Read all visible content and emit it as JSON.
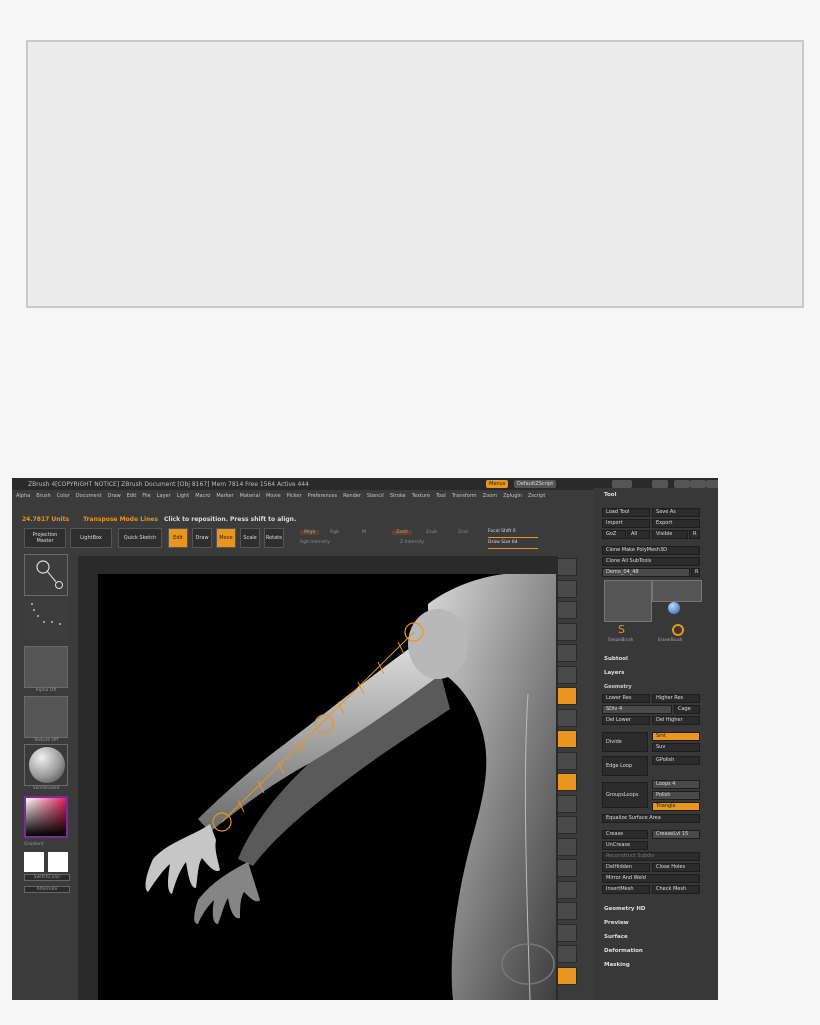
{
  "app": {
    "title": "ZBrush 4[COPYRIGHT NOTICE]  ZBrush Document  [Obj 8167] Mem 7814 Free 1564 Active 444",
    "menu": [
      "Alpha",
      "Brush",
      "Color",
      "Document",
      "Draw",
      "Edit",
      "File",
      "Layer",
      "Light",
      "Macro",
      "Marker",
      "Material",
      "Movie",
      "Picker",
      "Preferences",
      "Render",
      "Stencil",
      "Stroke",
      "Texture",
      "Tool",
      "Transform",
      "Zoom",
      "Zplugin",
      "Zscript"
    ],
    "top_buttons": {
      "menus": "Menus",
      "default_script": "DefaultZScript"
    },
    "status": {
      "value": "24.7817 Units",
      "mode": "Transpose Mode Lines",
      "hint": "Click to reposition. Press shift to align."
    },
    "toolbar": {
      "projection_master": "Projection Master",
      "lightbox": "LightBox",
      "quick_sketch": "Quick Sketch",
      "edit": "Edit",
      "draw": "Draw",
      "move": "Move",
      "scale": "Scale",
      "rotate": "Rotate",
      "mrgb": "Mrgb",
      "rgb": "Rgb",
      "m": "M",
      "zadd": "Zadd",
      "zsub": "Zsub",
      "zcut": "Zcut",
      "rgb_intensity": "Rgb Intensity",
      "z_intensity": "Z Intensity",
      "focal_shift": "Focal Shift 0",
      "draw_size": "Draw Size 64"
    },
    "left_shelf": {
      "alpha_off": "Alpha Off",
      "texture_off": "Texture Off",
      "material": "SkinShade4",
      "gradient": "Gradient",
      "switch_color": "SwitchColor",
      "alternate": "Alternate"
    },
    "tool_panel": {
      "title": "Tool",
      "load_tool": "Load Tool",
      "save_as": "Save As",
      "import": "Import",
      "export": "Export",
      "goz": "GoZ",
      "all": "All",
      "visible": "Visible",
      "r": "R",
      "clone_poly": "Clone Make PolyMesh3D",
      "clone_subtools": "Clone All SubTools",
      "current_tool": "Demo_04_48",
      "simple_brush": "SimpleBrush",
      "eraser": "EraserBrush",
      "subtool": "Subtool",
      "layers": "Layers",
      "geometry": "Geometry",
      "lower_res": "Lower Res",
      "higher_res": "Higher Res",
      "sdiv": "SDiv 4",
      "cage": "Cage",
      "del_lower": "Del Lower",
      "del_higher": "Del Higher",
      "divide": "Divide",
      "smt": "Smt",
      "suv": "Suv",
      "edge_loop": "Edge Loop",
      "gpolish": "GPolish",
      "groups_loops": "GroupsLoops",
      "loops": "Loops 4",
      "polish": "Polish",
      "triangle": "Triangle",
      "equalize": "Equalize Surface Area",
      "crease": "Crease",
      "uncrease": "UnCrease",
      "crease_level": "CreaseLvl 15",
      "reconstruct": "Reconstruct Subdiv",
      "del_hidden": "DelHidden",
      "close_holes": "Close Holes",
      "mirror_weld": "Mirror And Weld",
      "insert_mesh": "InsertMesh",
      "check_mesh": "Check Mesh",
      "sections": [
        "Geometry HD",
        "Preview",
        "Surface",
        "Deformation",
        "Masking"
      ]
    }
  }
}
